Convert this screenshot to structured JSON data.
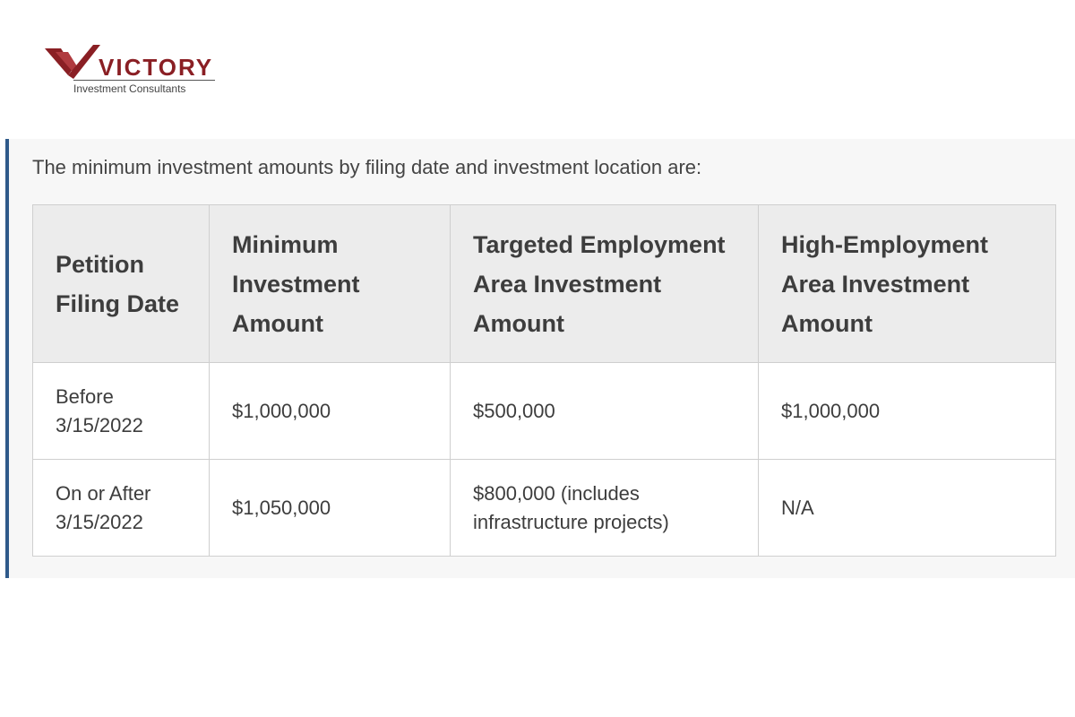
{
  "logo": {
    "wordmark": "VICTORY",
    "tagline": "Investment Consultants",
    "brand_color": "#8a1f24"
  },
  "intro": "The minimum investment amounts by filing date and investment location are:",
  "table": {
    "headers": [
      "Petition Filing Date",
      "Minimum Investment Amount",
      "Targeted Employment Area Investment Amount",
      "High-Employment Area Investment Amount"
    ],
    "rows": [
      [
        "Before 3/15/2022",
        "$1,000,000",
        "$500,000",
        "$1,000,000"
      ],
      [
        "On or After 3/15/2022",
        "$1,050,000",
        "$800,000 (includes infrastructure projects)",
        "N/A"
      ]
    ]
  },
  "colors": {
    "accent_bar": "#2f5a8a",
    "header_bg": "#ececec",
    "panel_bg": "#f7f7f7"
  }
}
